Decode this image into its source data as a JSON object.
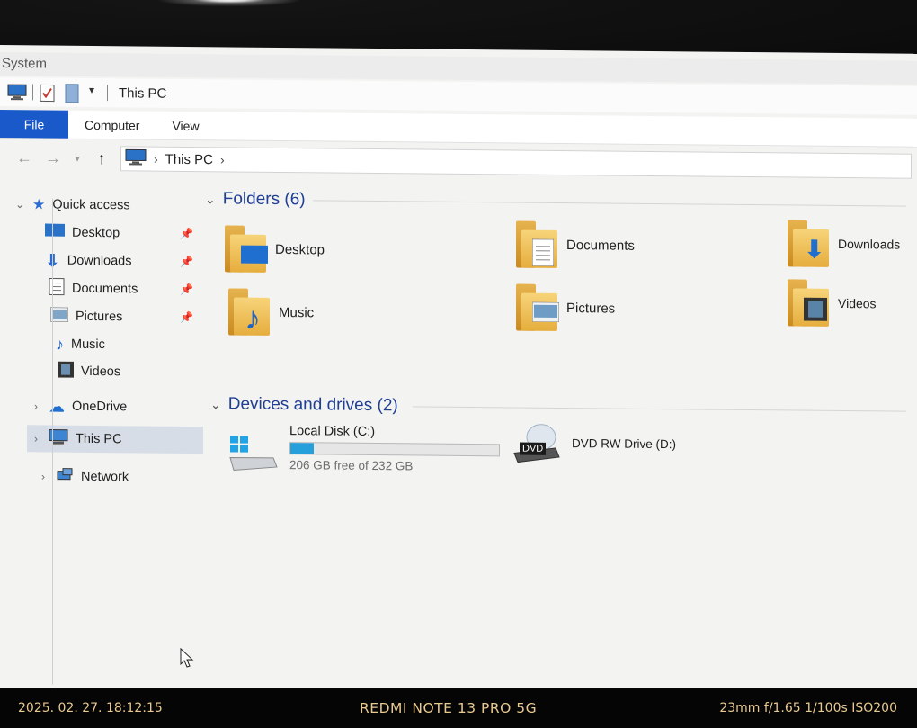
{
  "window": {
    "title": "System",
    "qat_title": "This PC"
  },
  "ribbon": {
    "tabs": [
      "File",
      "Computer",
      "View"
    ]
  },
  "address": {
    "crumbs": [
      "This PC"
    ]
  },
  "nav": {
    "quick_access": "Quick access",
    "items": [
      {
        "label": "Desktop",
        "pinned": true,
        "icon": "desktop-icon"
      },
      {
        "label": "Downloads",
        "pinned": true,
        "icon": "downloads-icon"
      },
      {
        "label": "Documents",
        "pinned": true,
        "icon": "documents-icon"
      },
      {
        "label": "Pictures",
        "pinned": true,
        "icon": "pictures-icon"
      },
      {
        "label": "Music",
        "pinned": false,
        "icon": "music-icon"
      },
      {
        "label": "Videos",
        "pinned": false,
        "icon": "videos-icon"
      }
    ],
    "onedrive": "OneDrive",
    "this_pc": "This PC",
    "network": "Network"
  },
  "content": {
    "folders_header": "Folders (6)",
    "folders": [
      {
        "label": "Desktop",
        "icon": "desktop-folder-icon"
      },
      {
        "label": "Documents",
        "icon": "documents-folder-icon"
      },
      {
        "label": "Downloads",
        "icon": "downloads-folder-icon"
      },
      {
        "label": "Music",
        "icon": "music-folder-icon"
      },
      {
        "label": "Pictures",
        "icon": "pictures-folder-icon"
      },
      {
        "label": "Videos",
        "icon": "videos-folder-icon"
      }
    ],
    "devices_header": "Devices and drives (2)",
    "drives": [
      {
        "label": "Local Disk (C:)",
        "free_text": "206 GB free of 232 GB",
        "used_fraction": 0.112
      },
      {
        "label": "DVD RW Drive (D:)",
        "badge": "DVD"
      }
    ]
  },
  "camera": {
    "datetime": "2025. 02. 27.  18:12:15",
    "model": "REDMI NOTE 13 PRO 5G",
    "exif": "23mm  f/1.65  1/100s  ISO200"
  },
  "colors": {
    "file_tab": "#1a59c9",
    "group_header": "#1f3f95",
    "drive_bar": "#26a0da",
    "camera_text": "#e8c98f"
  }
}
